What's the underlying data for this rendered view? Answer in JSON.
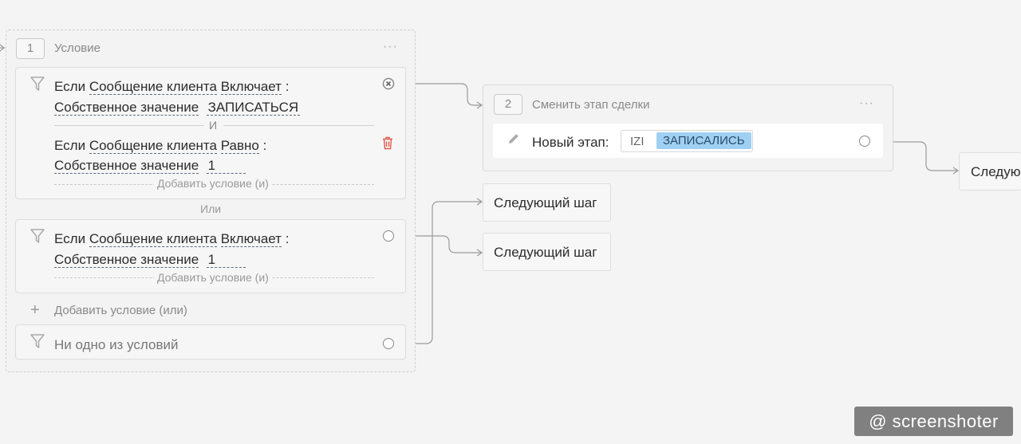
{
  "step1": {
    "number": "1",
    "title": "Условие",
    "menu": "···",
    "groups": [
      {
        "conditions": [
          {
            "if": "Если",
            "field": "Сообщение клиента",
            "operator": "Включает",
            "colon": ":",
            "value_type": "Собственное значение",
            "value": "ЗАПИСАТЬСЯ"
          },
          {
            "if": "Если",
            "field": "Сообщение клиента",
            "operator": "Равно",
            "colon": ":",
            "value_type": "Собственное значение",
            "value": "1"
          }
        ],
        "joiner": "И",
        "add_and": "Добавить условие (и)"
      },
      {
        "conditions": [
          {
            "if": "Если",
            "field": "Сообщение клиента",
            "operator": "Включает",
            "colon": ":",
            "value_type": "Собственное значение",
            "value": "1"
          }
        ],
        "add_and": "Добавить условие (и)"
      }
    ],
    "or_label": "Или",
    "add_or": "Добавить условие (или)",
    "none_label": "Ни одно из условий"
  },
  "step2": {
    "number": "2",
    "title": "Сменить этап сделки",
    "menu": "···",
    "field_label": "Новый этап:",
    "pipeline": "IZI",
    "stage": "ЗАПИСАЛИСЬ"
  },
  "next_steps": [
    "Следующий шаг",
    "Следующий шаг",
    "Следую"
  ],
  "watermark": "@ screenshoter",
  "colors": {
    "stage_tag": "#9fd0f3",
    "delete_icon": "#e05a4f",
    "background": "#f4f4f4"
  }
}
